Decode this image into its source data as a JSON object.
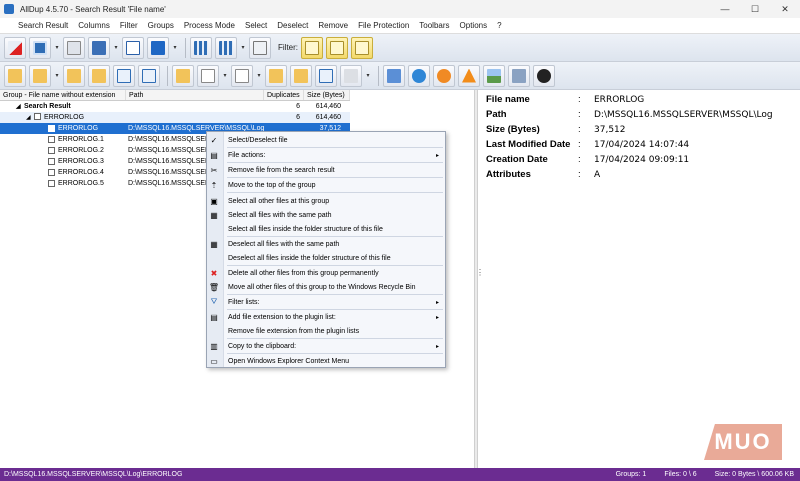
{
  "window": {
    "title": "AllDup 4.5.70 - Search Result 'File name'",
    "minimize": "—",
    "maximize": "☐",
    "close": "✕"
  },
  "menu": [
    "Search Result",
    "Columns",
    "Filter",
    "Groups",
    "Process Mode",
    "Select",
    "Deselect",
    "Remove",
    "File Protection",
    "Toolbars",
    "Options",
    "?"
  ],
  "toolbar": {
    "filter_label": "Filter:"
  },
  "tree": {
    "headers": [
      "Group - File name without extension",
      "Path",
      "Duplicates",
      "Size (Bytes)"
    ],
    "root": {
      "name": "Search Result",
      "dup": "6",
      "size": "614,460"
    },
    "group": {
      "name": "ERRORLOG",
      "dup": "6",
      "size": "614,460"
    },
    "files": [
      {
        "name": "ERRORLOG",
        "path": "D:\\MSSQL16.MSSQLSERVER\\MSSQL\\Log",
        "size": "37,512"
      },
      {
        "name": "ERRORLOG.1",
        "path": "D:\\MSSQL16.MSSQLSERVER"
      },
      {
        "name": "ERRORLOG.2",
        "path": "D:\\MSSQL16.MSSQLSERVER"
      },
      {
        "name": "ERRORLOG.3",
        "path": "D:\\MSSQL16.MSSQLSERVER"
      },
      {
        "name": "ERRORLOG.4",
        "path": "D:\\MSSQL16.MSSQLSERVER"
      },
      {
        "name": "ERRORLOG.5",
        "path": "D:\\MSSQL16.MSSQLSERVER"
      }
    ]
  },
  "details": [
    {
      "key": "File name",
      "value": "ERRORLOG"
    },
    {
      "key": "Path",
      "value": "D:\\MSSQL16.MSSQLSERVER\\MSSQL\\Log"
    },
    {
      "key": "Size (Bytes)",
      "value": "37,512"
    },
    {
      "key": "Last Modified Date",
      "value": "17/04/2024 14:07:44"
    },
    {
      "key": "Creation Date",
      "value": "17/04/2024 09:09:11"
    },
    {
      "key": "Attributes",
      "value": "A"
    }
  ],
  "context_menu": {
    "items": [
      {
        "label": "Select/Deselect file",
        "icon": "✓"
      },
      {
        "label": "File actions:",
        "icon": "▤",
        "submenu": "▸"
      },
      {
        "label": "Remove file from the search result",
        "icon": "✂"
      },
      {
        "label": "Move to the top of the group",
        "icon": "⇡"
      },
      {
        "label": "Select all other files at this group",
        "icon": "▣"
      },
      {
        "label": "Select all files with the same path",
        "icon": "▦"
      },
      {
        "label": "Select all files inside the folder structure of this file",
        "icon": ""
      },
      {
        "label": "Deselect all files with the same path",
        "icon": "▦"
      },
      {
        "label": "Deselect all files inside the folder structure of this file",
        "icon": ""
      },
      {
        "label": "Delete all other files from this group permanently",
        "icon": "✖"
      },
      {
        "label": "Move all other files of this group to the Windows Recycle Bin",
        "icon": "🗑"
      },
      {
        "label": "Filter lists:",
        "icon": "⛛",
        "submenu": "▸"
      },
      {
        "label": "Add file extension to the plugin list:",
        "icon": "▤",
        "submenu": "▸"
      },
      {
        "label": "Remove file extension from the plugin lists",
        "icon": ""
      },
      {
        "label": "Copy to the clipboard:",
        "icon": "▥",
        "submenu": "▸"
      },
      {
        "label": "Open Windows Explorer Context Menu",
        "icon": "▭"
      }
    ]
  },
  "status": {
    "path": "D:\\MSSQL16.MSSQLSERVER\\MSSQL\\Log\\ERRORLOG",
    "groups": "Groups: 1",
    "files": "Files: 0 \\ 6",
    "size": "Size: 0 Bytes \\ 600.06 KB"
  },
  "logo": {
    "text": "MUO"
  },
  "colors": {
    "status_bar": "#6b2c91",
    "selection": "#1f6fd0",
    "logo": "#e9aa98"
  }
}
